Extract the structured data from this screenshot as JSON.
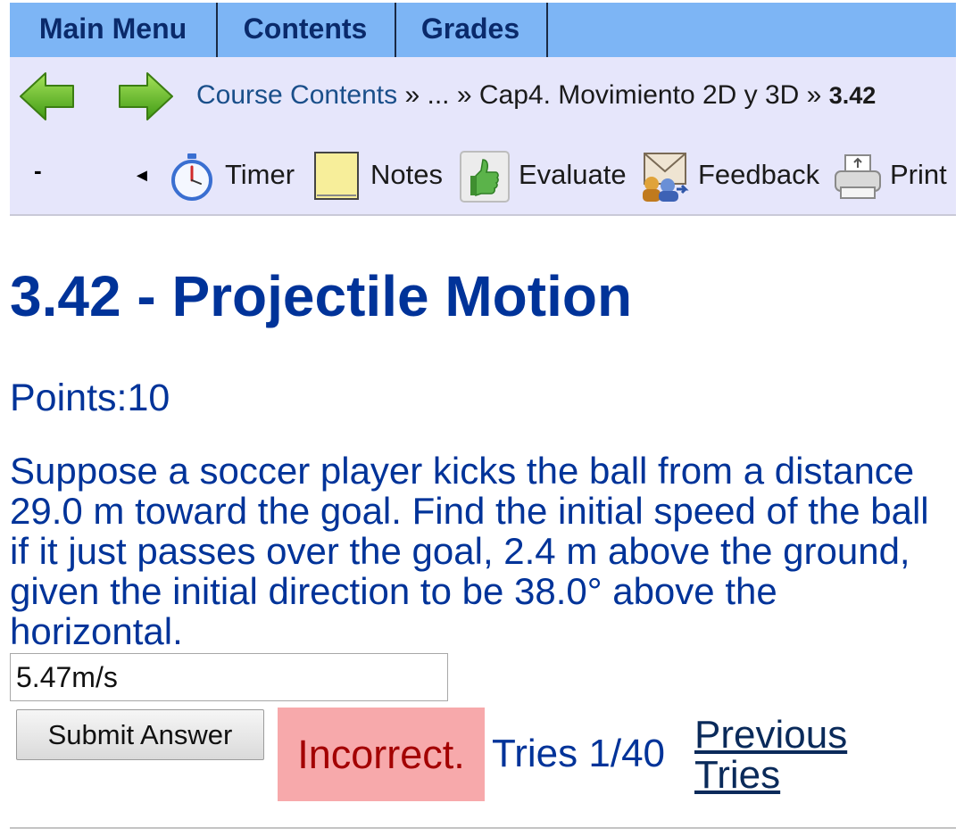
{
  "menu": {
    "main_menu": "Main Menu",
    "contents": "Contents",
    "grades": "Grades"
  },
  "nav": {
    "back_icon": "green-left-arrow",
    "forward_icon": "green-right-arrow",
    "breadcrumb": {
      "course_contents": "Course Contents",
      "sep1": " » ",
      "ellipsis": "...",
      "sep2": " » ",
      "chapter": "Cap4. Movimiento 2D y 3D",
      "sep3": " » ",
      "current": "3.42"
    }
  },
  "tools": {
    "dash": "-",
    "collapse_glyph": "◄",
    "timer": "Timer",
    "notes": "Notes",
    "evaluate": "Evaluate",
    "feedback": "Feedback",
    "print": "Print"
  },
  "problem": {
    "title": "3.42 - Projectile Motion",
    "points": "Points:10",
    "question": "Suppose a soccer player kicks the ball from a distance 29.0 m toward the goal. Find the initial speed of the ball if it just passes over the goal, 2.4 m above the ground, given the initial direction to be 38.0° above the horizontal.",
    "answer_value": "5.47m/s",
    "submit_label": "Submit Answer",
    "result": "Incorrect.",
    "tries": "Tries 1/40",
    "previous_tries": "Previous Tries"
  },
  "colors": {
    "menu_bg": "#7db5f5",
    "nav_bg": "#e6e6fb",
    "title_blue": "#003399",
    "incorrect_bg": "#f7a9ab",
    "incorrect_text": "#a30000"
  }
}
